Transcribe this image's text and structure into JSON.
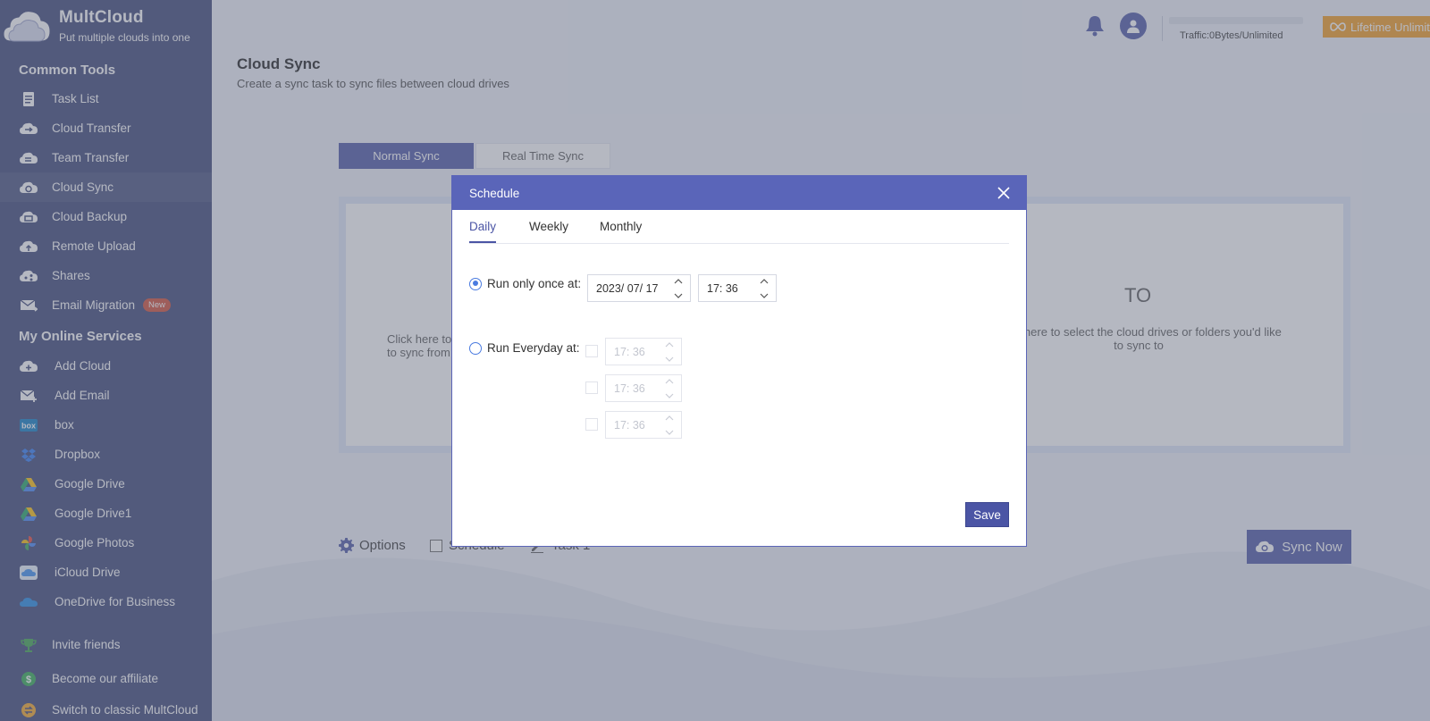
{
  "app": {
    "name": "MultCloud",
    "tagline": "Put multiple clouds into one"
  },
  "sidebar": {
    "common_tools_title": "Common Tools",
    "common_tools": [
      {
        "label": "Task List",
        "icon": "task-list-icon"
      },
      {
        "label": "Cloud Transfer",
        "icon": "cloud-transfer-icon"
      },
      {
        "label": "Team Transfer",
        "icon": "team-transfer-icon"
      },
      {
        "label": "Cloud Sync",
        "icon": "cloud-sync-icon",
        "active": true
      },
      {
        "label": "Cloud Backup",
        "icon": "cloud-backup-icon"
      },
      {
        "label": "Remote Upload",
        "icon": "remote-upload-icon"
      },
      {
        "label": "Shares",
        "icon": "shares-icon"
      },
      {
        "label": "Email Migration",
        "icon": "email-migration-icon",
        "badge": "New"
      }
    ],
    "services_title": "My Online Services",
    "services": [
      {
        "label": "Add Cloud",
        "icon": "add-cloud-icon"
      },
      {
        "label": "Add Email",
        "icon": "add-email-icon"
      },
      {
        "label": "box",
        "icon": "box-icon"
      },
      {
        "label": "Dropbox",
        "icon": "dropbox-icon"
      },
      {
        "label": "Google Drive",
        "icon": "google-drive-icon"
      },
      {
        "label": "Google Drive1",
        "icon": "google-drive-icon"
      },
      {
        "label": "Google Photos",
        "icon": "google-photos-icon"
      },
      {
        "label": "iCloud Drive",
        "icon": "icloud-drive-icon"
      },
      {
        "label": "OneDrive for Business",
        "icon": "onedrive-icon"
      }
    ],
    "footer": [
      {
        "label": "Invite friends",
        "icon": "trophy-icon"
      },
      {
        "label": "Become our affiliate",
        "icon": "dollar-icon"
      },
      {
        "label": "Switch to classic MultCloud",
        "icon": "switch-icon"
      }
    ]
  },
  "topbar": {
    "traffic": "Traffic:0Bytes/Unlimited",
    "lifetime": "Lifetime Unlimited"
  },
  "page": {
    "title": "Cloud Sync",
    "subtitle": "Create a sync task to sync files between cloud drives",
    "mode_tabs": [
      "Normal Sync",
      "Real Time Sync"
    ],
    "from_hint": "Click here to select the cloud drives or folders you'd like to sync from",
    "to_title": "TO",
    "to_hint": "Click here to select the cloud drives or folders you'd like to sync to",
    "options_label": "Options",
    "schedule_label": "Schedule",
    "task_label": "Task 1",
    "sync_now_label": "Sync Now"
  },
  "modal": {
    "title": "Schedule",
    "tabs": [
      "Daily",
      "Weekly",
      "Monthly"
    ],
    "active_tab": "Daily",
    "run_once_label": "Run only once at:",
    "run_once_date": "2023/ 07/ 17",
    "run_once_time": "17: 36",
    "run_everyday_label": "Run Everyday at:",
    "everyday_times": [
      "17: 36",
      "17: 36",
      "17: 36"
    ],
    "save_label": "Save"
  },
  "colors": {
    "sidebar_bg": "#394274",
    "accent": "#4b55a5",
    "modal_header": "#5a65b9",
    "lifetime": "#f39a1c"
  }
}
